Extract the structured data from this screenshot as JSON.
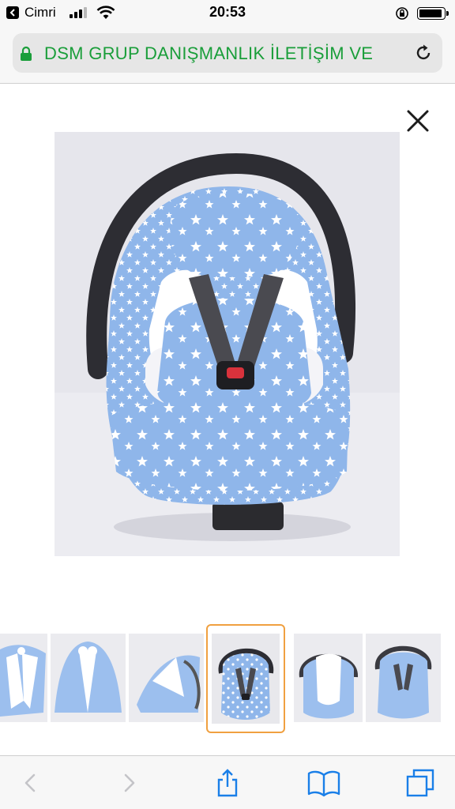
{
  "status_bar": {
    "back_app": "Cimri",
    "time": "20:53"
  },
  "address_bar": {
    "url_text": "DSM GRUP DANIŞMANLIK İLETİŞİM VE",
    "url_color": "#1a9e3a"
  },
  "viewer": {
    "close_icon": "close-icon",
    "main_image": "baby-car-seat-cover-blue-stars",
    "thumbnails": [
      {
        "name": "canopy-cover-front"
      },
      {
        "name": "canopy-cover-bow"
      },
      {
        "name": "canopy-cover-side"
      },
      {
        "name": "car-seat-cover-stars",
        "selected": true
      },
      {
        "name": "car-seat-white-insert"
      },
      {
        "name": "car-seat-cover-plain"
      }
    ],
    "selected_color": "#f0a040"
  },
  "toolbar": {
    "items": [
      "back-icon",
      "forward-icon",
      "share-icon",
      "bookmarks-icon",
      "tabs-icon"
    ],
    "accent": "#1a7fe8"
  }
}
